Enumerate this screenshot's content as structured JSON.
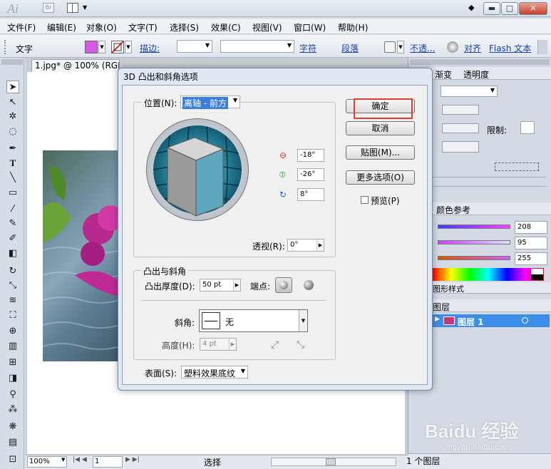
{
  "app": {
    "logo": "Ai",
    "bridge": "Br"
  },
  "window": {
    "minimize": "▬",
    "maximize": "□",
    "close": "✕"
  },
  "menu": [
    "文件(F)",
    "编辑(E)",
    "对象(O)",
    "文字(T)",
    "选择(S)",
    "效果(C)",
    "视图(V)",
    "窗口(W)",
    "帮助(H)"
  ],
  "control": {
    "mode_label": "文字",
    "fill_color": "#d65ae8",
    "stroke_label": "描边:",
    "char_link": "字符",
    "para_link": "段落",
    "opacity_link": "不透...",
    "align_link": "对齐",
    "flash_link": "Flash 文本"
  },
  "document": {
    "tab_title": "1.jpg* @ 100% (RGB/预览)"
  },
  "status": {
    "zoom": "100%",
    "page": "1",
    "selection": "选择"
  },
  "right_panel": {
    "tabs": [
      "渐变",
      "透明度"
    ],
    "limit_label": "限制:",
    "color_ref_tab": "颜色参考",
    "rgb": [
      {
        "value": "208"
      },
      {
        "value": "95"
      },
      {
        "value": "255"
      }
    ],
    "graphic_style_tab": "图形样式",
    "layers_tab": "图层",
    "layer_name": "图层 1",
    "layer_count": "1 个图层"
  },
  "dialog": {
    "title": "3D 凸出和斜角选项",
    "position_label": "位置(N):",
    "position_value": "离轴 - 前方",
    "rot_x": "-18°",
    "rot_y": "-26°",
    "rot_z": "8°",
    "perspective_label": "透视(R):",
    "perspective_value": "0°",
    "ok": "确定",
    "cancel": "取消",
    "map": "贴图(M)...",
    "more": "更多选项(O)",
    "preview": "预览(P)",
    "extrude_group": "凸出与斜角",
    "depth_label": "凸出厚度(D):",
    "depth_value": "50 pt",
    "cap_label": "端点:",
    "bevel_label": "斜角:",
    "bevel_value": "无",
    "height_label": "高度(H):",
    "height_value": "4 pt",
    "surface_label": "表面(S):",
    "surface_value": "塑料效果底纹"
  },
  "watermark": {
    "text": "Baidu 经验",
    "url": "jingyan.baidu.com"
  },
  "colors": {
    "highlight": "#e33b3b",
    "cube_front": "#5fa6bf",
    "cube_top": "#d6d6d6",
    "cube_side": "#9a9a9a",
    "layer_blue": "#3d8ee8"
  }
}
